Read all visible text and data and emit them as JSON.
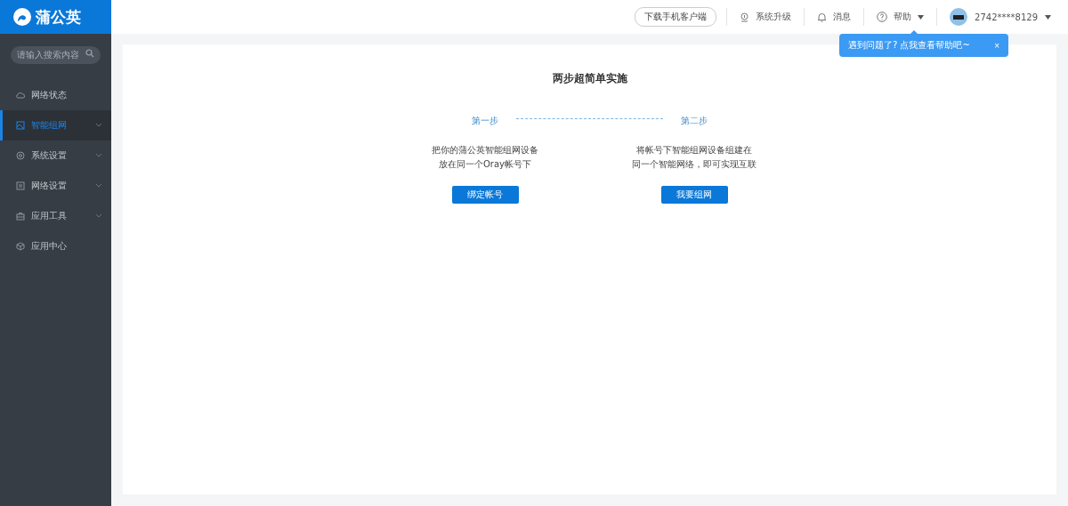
{
  "logo": {
    "text": "蒲公英"
  },
  "search": {
    "placeholder": "请输入搜索内容"
  },
  "sidebar": {
    "items": [
      {
        "label": "网络状态",
        "kind": "cloud",
        "selected": false,
        "expandable": false
      },
      {
        "label": "智能组网",
        "kind": "image",
        "selected": true,
        "expandable": true
      },
      {
        "label": "系统设置",
        "kind": "gear",
        "selected": false,
        "expandable": true
      },
      {
        "label": "网络设置",
        "kind": "doc",
        "selected": false,
        "expandable": true
      },
      {
        "label": "应用工具",
        "kind": "case",
        "selected": false,
        "expandable": true
      },
      {
        "label": "应用中心",
        "kind": "cube",
        "selected": false,
        "expandable": false
      }
    ]
  },
  "topbar": {
    "download": "下载手机客户端",
    "upgrade": "系统升级",
    "messages": "消息",
    "help": "帮助",
    "user": "2742****8129"
  },
  "tooltip": {
    "text": "遇到问题了? 点我查看帮助吧~",
    "close": "×"
  },
  "main": {
    "title": "两步超简单实施",
    "steps": [
      {
        "label": "第一步",
        "lines": [
          "把你的蒲公英智能组网设备",
          "放在同一个Oray帐号下"
        ],
        "button": "绑定帐号"
      },
      {
        "label": "第二步",
        "lines": [
          "将帐号下智能组网设备组建在",
          "同一个智能网络，即可实现互联"
        ],
        "button": "我要组网"
      }
    ]
  }
}
